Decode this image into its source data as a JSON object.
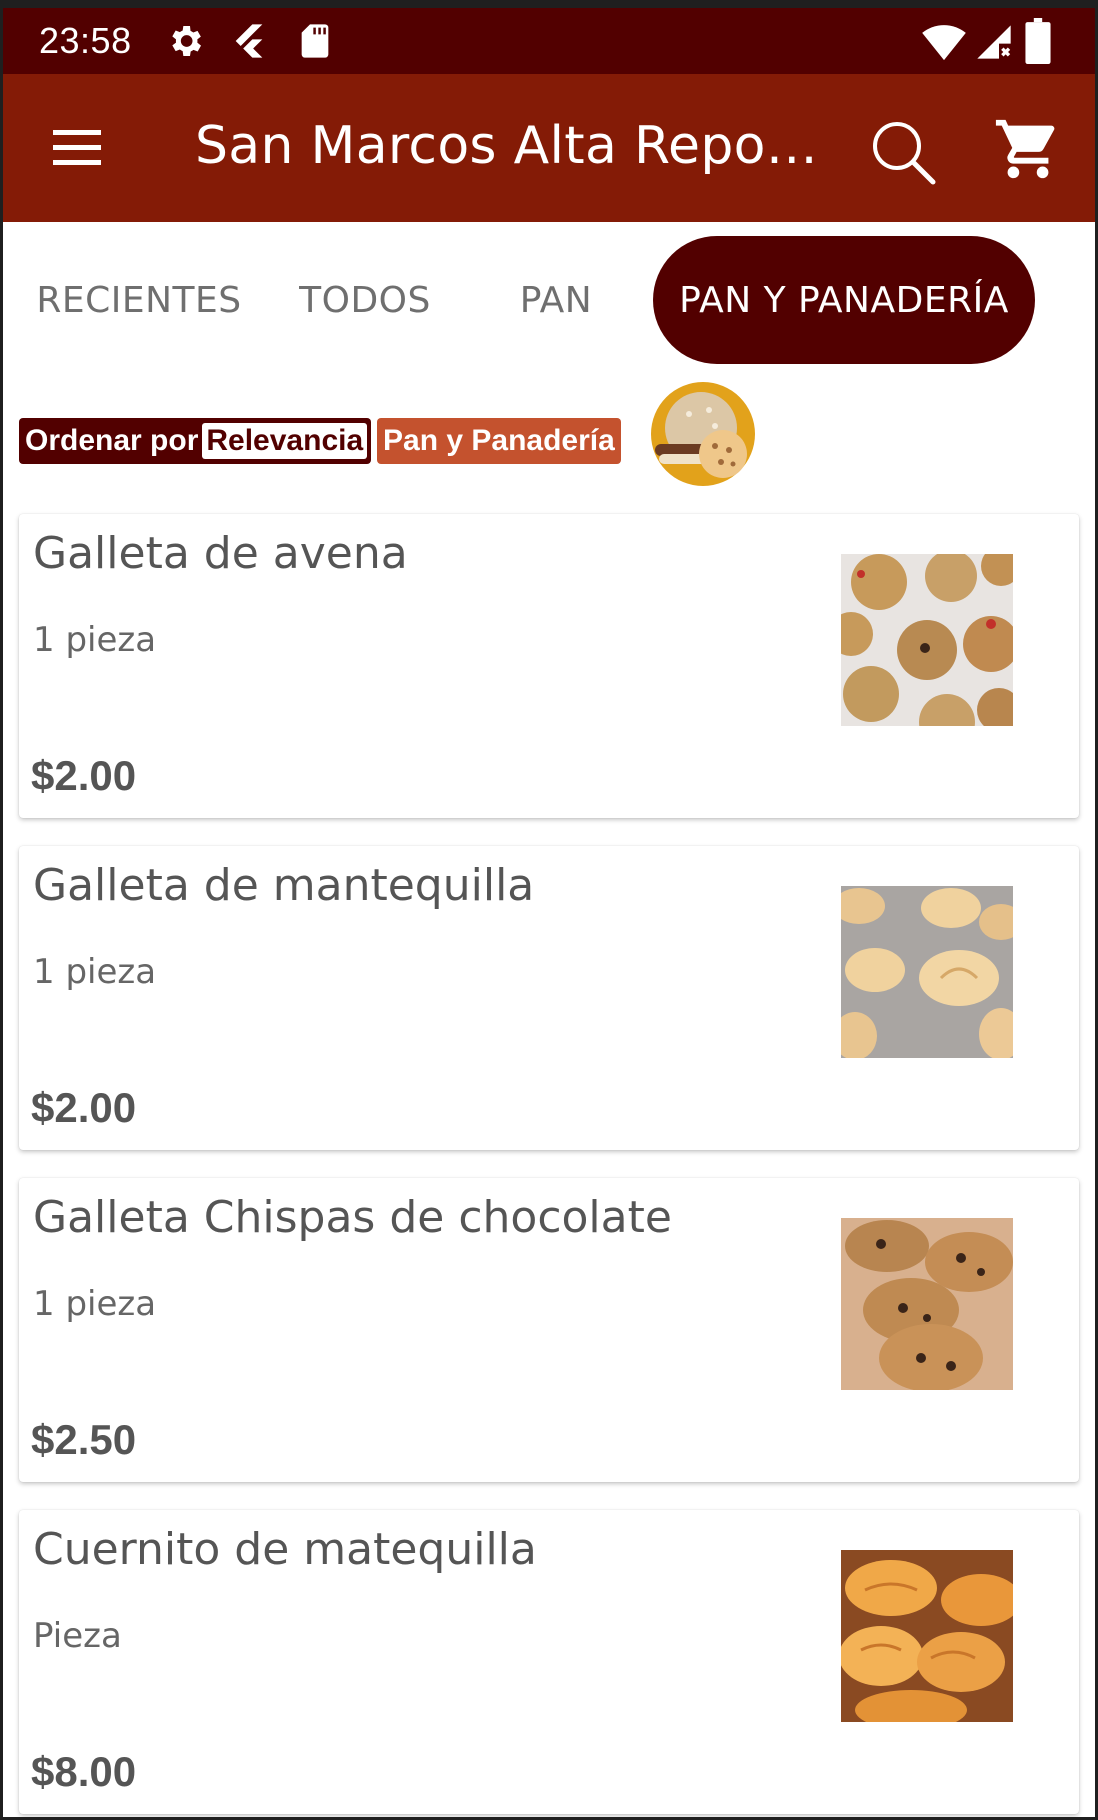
{
  "status_bar": {
    "time": "23:58",
    "icons": [
      "gear-icon",
      "flutter-icon",
      "sd-card-icon",
      "wifi-icon",
      "signal-icon",
      "battery-icon"
    ]
  },
  "app_bar": {
    "title": "San Marcos Alta Repost…",
    "icons": [
      "menu-icon",
      "search-icon",
      "cart-icon"
    ]
  },
  "tabs": [
    {
      "label": "RECIENTES",
      "selected": false
    },
    {
      "label": "TODOS",
      "selected": false
    },
    {
      "label": "PAN",
      "selected": false
    },
    {
      "label": "PAN Y PANADERÍA",
      "selected": true
    }
  ],
  "filters": {
    "sort_prefix": "Ordenar por",
    "sort_value": "Relevancia",
    "category": "Pan y Panadería"
  },
  "products": [
    {
      "name": "Galleta de avena",
      "unit": "1 pieza",
      "price": "$2.00"
    },
    {
      "name": "Galleta de mantequilla",
      "unit": "1 pieza",
      "price": "$2.00"
    },
    {
      "name": "Galleta Chispas de chocolate",
      "unit": "1 pieza",
      "price": "$2.50"
    },
    {
      "name": "Cuernito de matequilla",
      "unit": "Pieza",
      "price": "$8.00"
    }
  ],
  "colors": {
    "status_bar": "#520000",
    "app_bar": "#841b06",
    "selected_tab": "#520000",
    "category_chip": "#c4522e"
  }
}
